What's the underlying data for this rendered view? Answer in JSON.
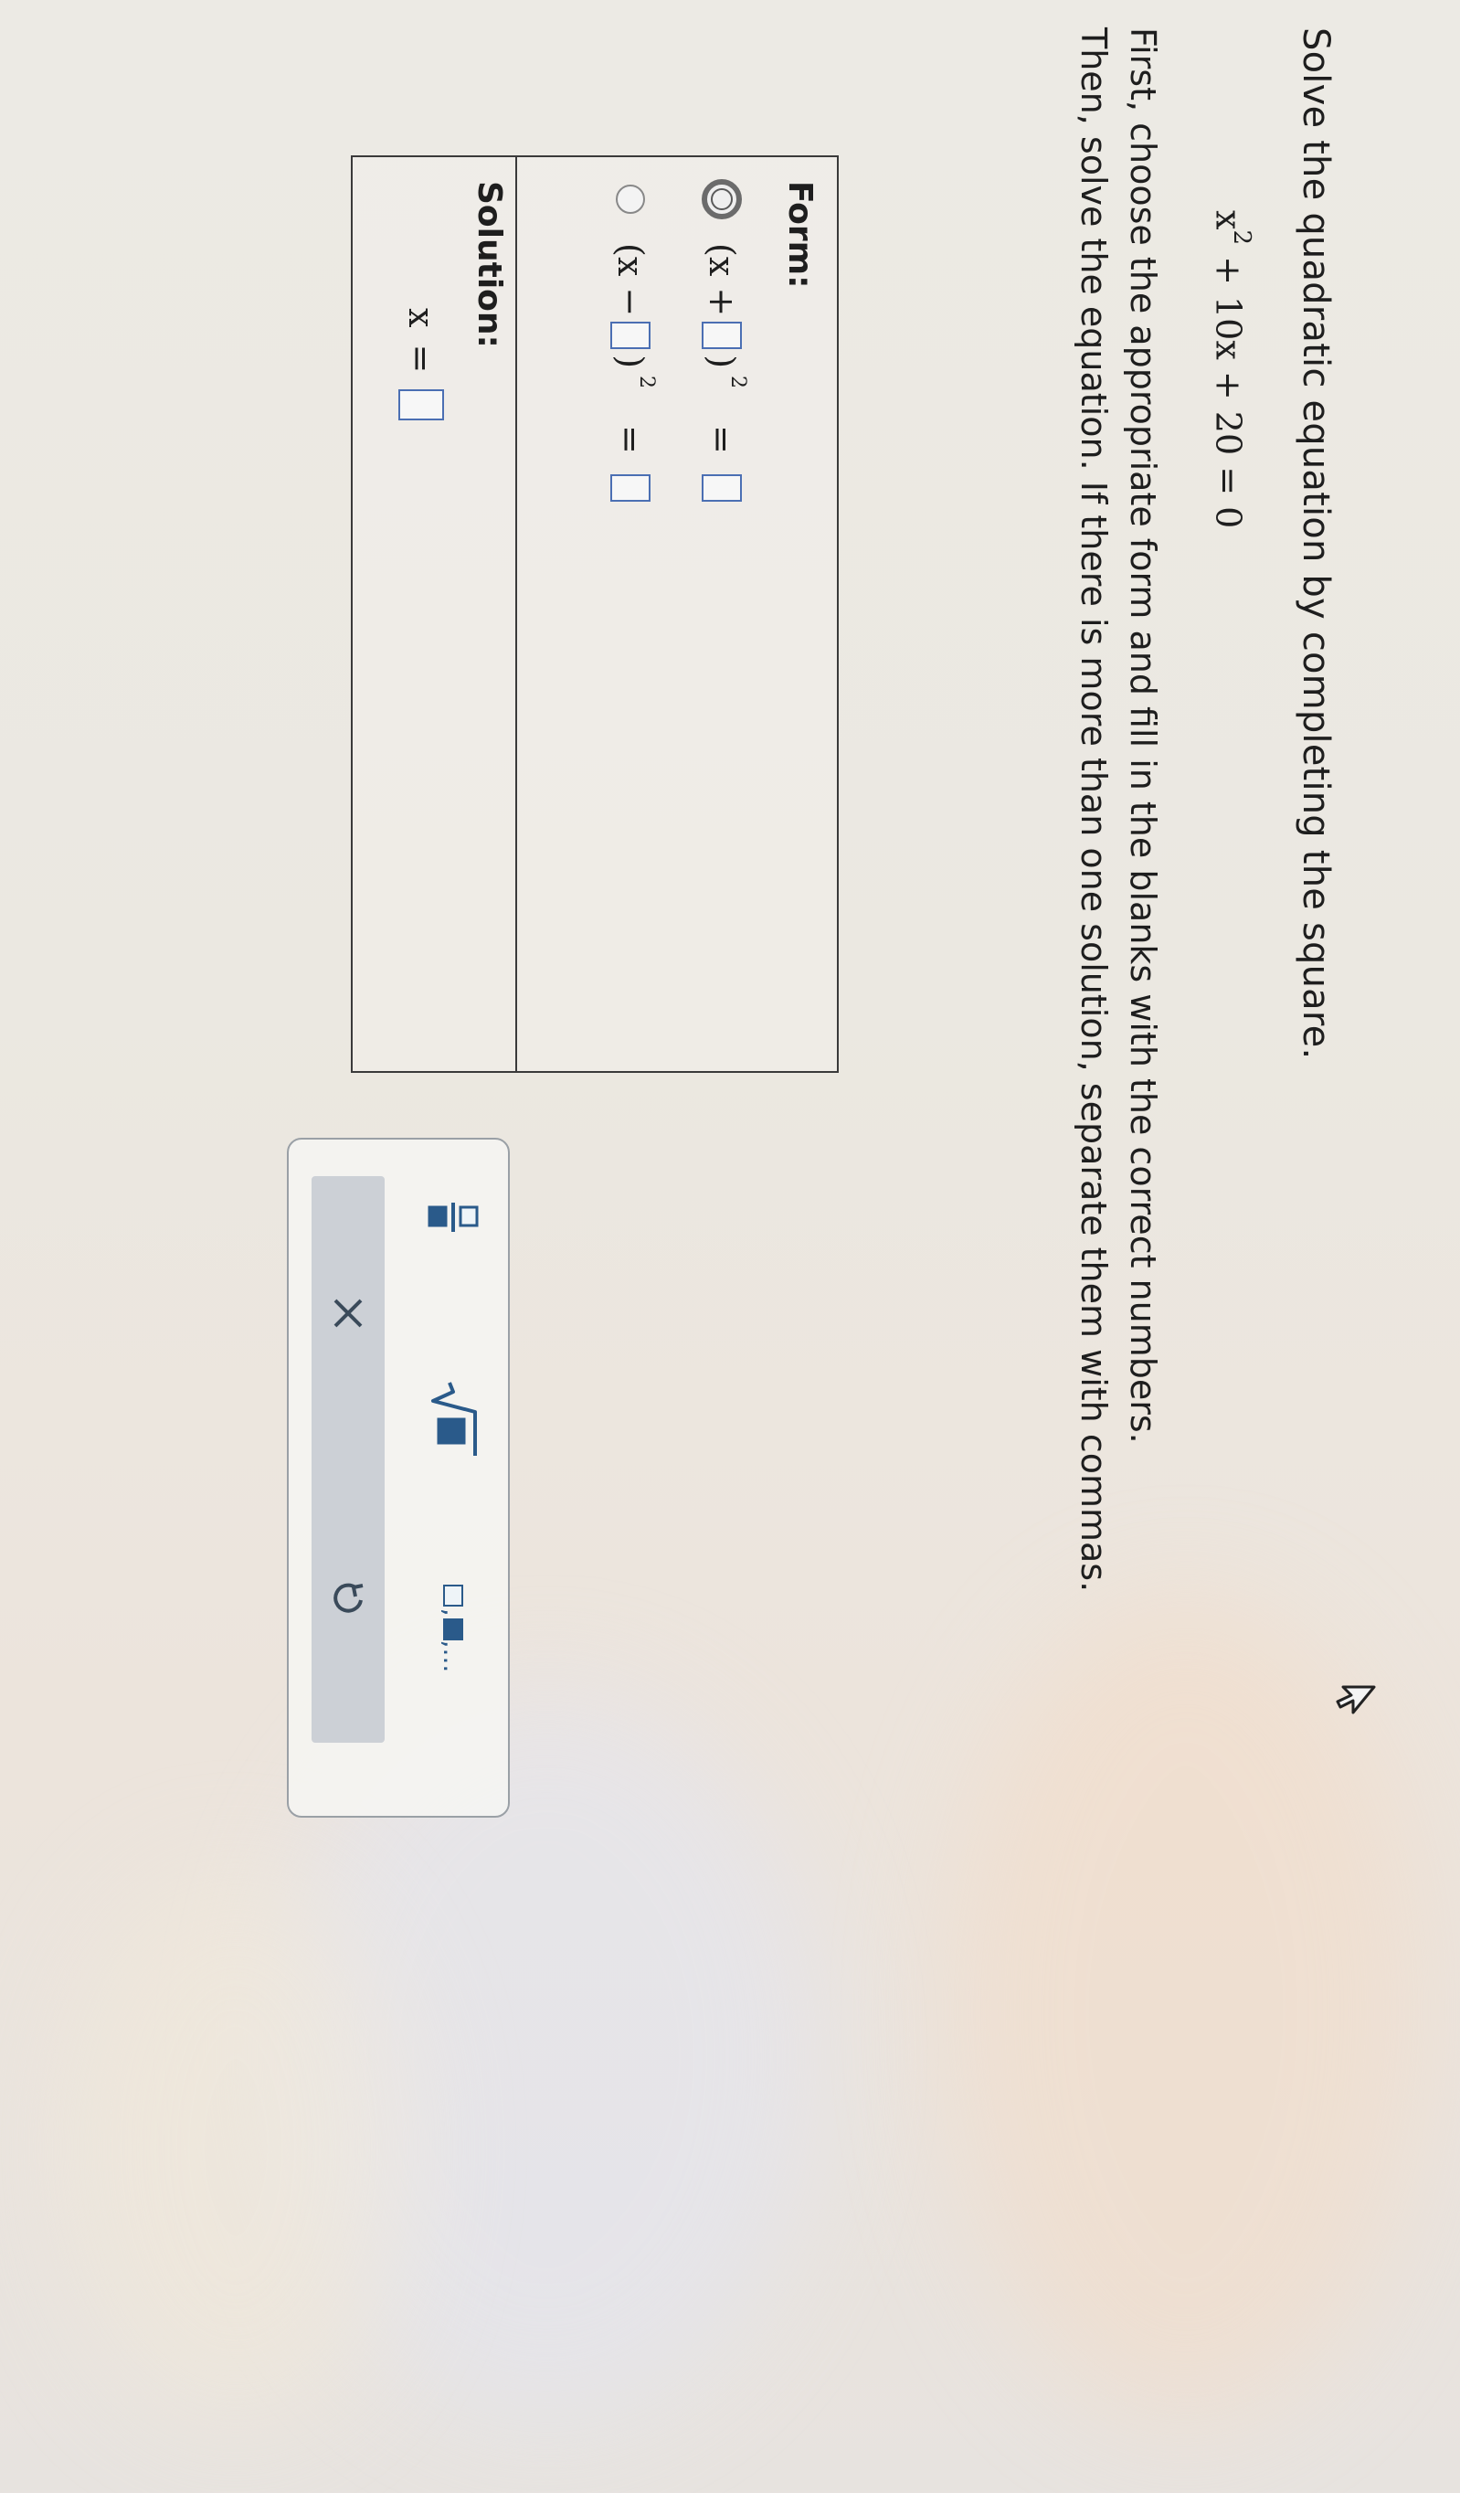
{
  "problem": {
    "title": "Solve the quadratic equation by completing the square.",
    "equation": {
      "base": "x",
      "exponent": "2",
      "rest": "+ 10x + 20 = 0"
    },
    "instructions_line1": "First, choose the appropriate form and fill in the blanks with the correct numbers.",
    "instructions_line2": "Then, solve the equation. If there is more than one solution, separate them with commas."
  },
  "answer": {
    "form_label": "Form:",
    "solution_label": "Solution:",
    "options": [
      {
        "prefix": "(x +",
        "suffix": ")",
        "exponent": "2",
        "equals": "=",
        "selected": true
      },
      {
        "prefix": "(x −",
        "suffix": ")",
        "exponent": "2",
        "equals": "=",
        "selected": false
      }
    ],
    "solution_var": "x",
    "solution_equals": "="
  },
  "toolbar": {
    "tools": [
      "fraction-icon",
      "sqrt-icon",
      "list-icon",
      "clear-icon",
      "undo-icon"
    ],
    "list_ellipsis": ",..."
  },
  "colors": {
    "blank_border": "#4b6fb3",
    "toolbar_row_bg": "#ccd0d6",
    "icon_blue": "#2a5a8a"
  }
}
